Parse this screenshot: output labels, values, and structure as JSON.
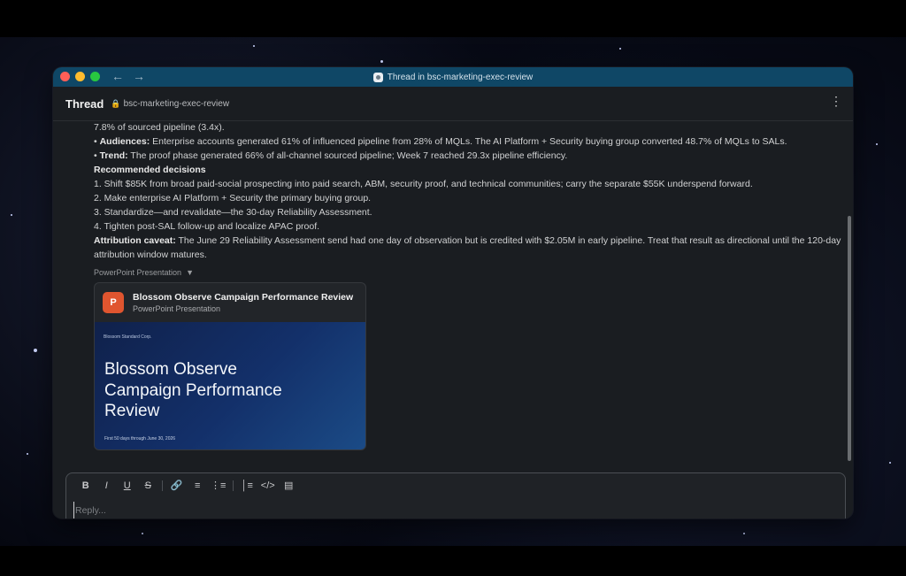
{
  "window": {
    "title": "Thread in bsc-marketing-exec-review",
    "back_icon": "arrow-left-icon",
    "forward_icon": "arrow-right-icon"
  },
  "thread_header": {
    "title": "Thread",
    "channel": "bsc-marketing-exec-review",
    "more_icon": "vertical-ellipsis-icon"
  },
  "message": {
    "partial_line": "7.8% of sourced pipeline (3.4x).",
    "bullets": [
      {
        "label": "Audiences:",
        "text": " Enterprise accounts generated 61% of influenced pipeline from 28% of MQLs. The AI Platform + Security buying group converted 48.7% of MQLs to SALs."
      },
      {
        "label": "Trend:",
        "text": " The proof phase generated 66% of all-channel sourced pipeline; Week 7 reached 29.3x pipeline efficiency."
      }
    ],
    "decisions_heading": "Recommended decisions",
    "decisions": [
      "1. Shift $85K from broad paid-social prospecting into paid search, ABM, security proof, and technical communities; carry the separate $55K underspend forward.",
      "2. Make enterprise AI Platform + Security the primary buying group.",
      "3. Standardize—and revalidate—the 30-day Reliability Assessment.",
      "4. Tighten post-SAL follow-up and localize APAC proof."
    ],
    "caveat_label": "Attribution caveat:",
    "caveat_text": " The June 29 Reliability Assessment send had one day of observation but is credited with $2.05M in early pipeline. Treat that result as directional until the 120-day attribution window matures."
  },
  "attachment": {
    "section_label": "PowerPoint Presentation",
    "file_title": "Blossom Observe Campaign Performance Review",
    "file_type": "PowerPoint Presentation",
    "icon_letter": "P",
    "slide_corp": "Blossom Standard Corp.",
    "slide_title": "Blossom Observe Campaign Performance Review",
    "slide_footer": "First 50 days through June 30, 2026"
  },
  "composer": {
    "placeholder": "Reply...",
    "value": "",
    "tools": [
      "bold-icon",
      "italic-icon",
      "underline-icon",
      "strikethrough-icon",
      "link-icon",
      "numbered-list-icon",
      "bulleted-list-icon",
      "blockquote-icon",
      "code-icon",
      "code-block-icon"
    ]
  },
  "colors": {
    "titlebar": "#0f4766",
    "background": "#1a1d21",
    "ppt_accent": "#e0552f"
  }
}
